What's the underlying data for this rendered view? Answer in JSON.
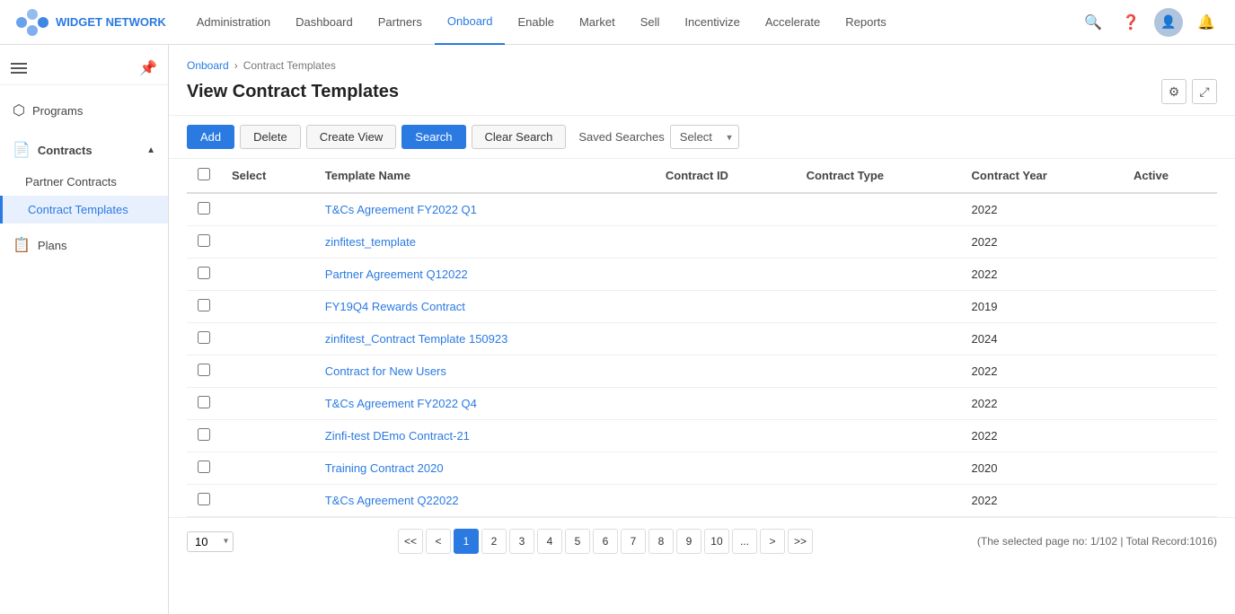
{
  "app": {
    "logo_text": "WIDGET NETWORK"
  },
  "nav": {
    "links": [
      {
        "label": "Administration",
        "id": "administration",
        "active": false
      },
      {
        "label": "Dashboard",
        "id": "dashboard",
        "active": false
      },
      {
        "label": "Partners",
        "id": "partners",
        "active": false
      },
      {
        "label": "Onboard",
        "id": "onboard",
        "active": true
      },
      {
        "label": "Enable",
        "id": "enable",
        "active": false
      },
      {
        "label": "Market",
        "id": "market",
        "active": false
      },
      {
        "label": "Sell",
        "id": "sell",
        "active": false
      },
      {
        "label": "Incentivize",
        "id": "incentivize",
        "active": false
      },
      {
        "label": "Accelerate",
        "id": "accelerate",
        "active": false
      },
      {
        "label": "Reports",
        "id": "reports",
        "active": false
      }
    ]
  },
  "sidebar": {
    "programs_label": "Programs",
    "contracts_label": "Contracts",
    "partner_contracts_label": "Partner Contracts",
    "contract_templates_label": "Contract Templates",
    "plans_label": "Plans"
  },
  "breadcrumb": {
    "root": "Onboard",
    "sep": "›",
    "current": "Contract Templates"
  },
  "page": {
    "title": "View Contract Templates"
  },
  "toolbar": {
    "add_label": "Add",
    "delete_label": "Delete",
    "create_view_label": "Create View",
    "search_label": "Search",
    "clear_search_label": "Clear Search",
    "saved_searches_label": "Saved Searches",
    "select_placeholder": "Select"
  },
  "table": {
    "headers": {
      "select": "Select",
      "template_name": "Template Name",
      "contract_id": "Contract ID",
      "contract_type": "Contract Type",
      "contract_year": "Contract Year",
      "active": "Active"
    },
    "rows": [
      {
        "name": "T&Cs Agreement FY2022 Q1",
        "contract_id": "",
        "contract_type": "",
        "contract_year": "2022",
        "active": ""
      },
      {
        "name": "zinfitest_template",
        "contract_id": "",
        "contract_type": "",
        "contract_year": "2022",
        "active": ""
      },
      {
        "name": "Partner Agreement Q12022",
        "contract_id": "",
        "contract_type": "",
        "contract_year": "2022",
        "active": ""
      },
      {
        "name": "FY19Q4 Rewards Contract",
        "contract_id": "",
        "contract_type": "",
        "contract_year": "2019",
        "active": ""
      },
      {
        "name": "zinfitest_Contract Template 150923",
        "contract_id": "",
        "contract_type": "",
        "contract_year": "2024",
        "active": ""
      },
      {
        "name": "Contract for New Users",
        "contract_id": "",
        "contract_type": "",
        "contract_year": "2022",
        "active": ""
      },
      {
        "name": "T&Cs Agreement FY2022 Q4",
        "contract_id": "",
        "contract_type": "",
        "contract_year": "2022",
        "active": ""
      },
      {
        "name": "Zinfi-test DEmo Contract-21",
        "contract_id": "",
        "contract_type": "",
        "contract_year": "2022",
        "active": ""
      },
      {
        "name": "Training Contract 2020",
        "contract_id": "",
        "contract_type": "",
        "contract_year": "2020",
        "active": ""
      },
      {
        "name": "T&Cs Agreement Q22022",
        "contract_id": "",
        "contract_type": "",
        "contract_year": "2022",
        "active": ""
      }
    ]
  },
  "pagination": {
    "page_size": "10",
    "pages": [
      "<<",
      "<",
      "1",
      "2",
      "3",
      "4",
      "5",
      "6",
      "7",
      "8",
      "9",
      "10",
      "...",
      ">",
      ">>"
    ],
    "active_page": "1",
    "info": "(The selected page no: 1/102 | Total Record:1016)"
  }
}
